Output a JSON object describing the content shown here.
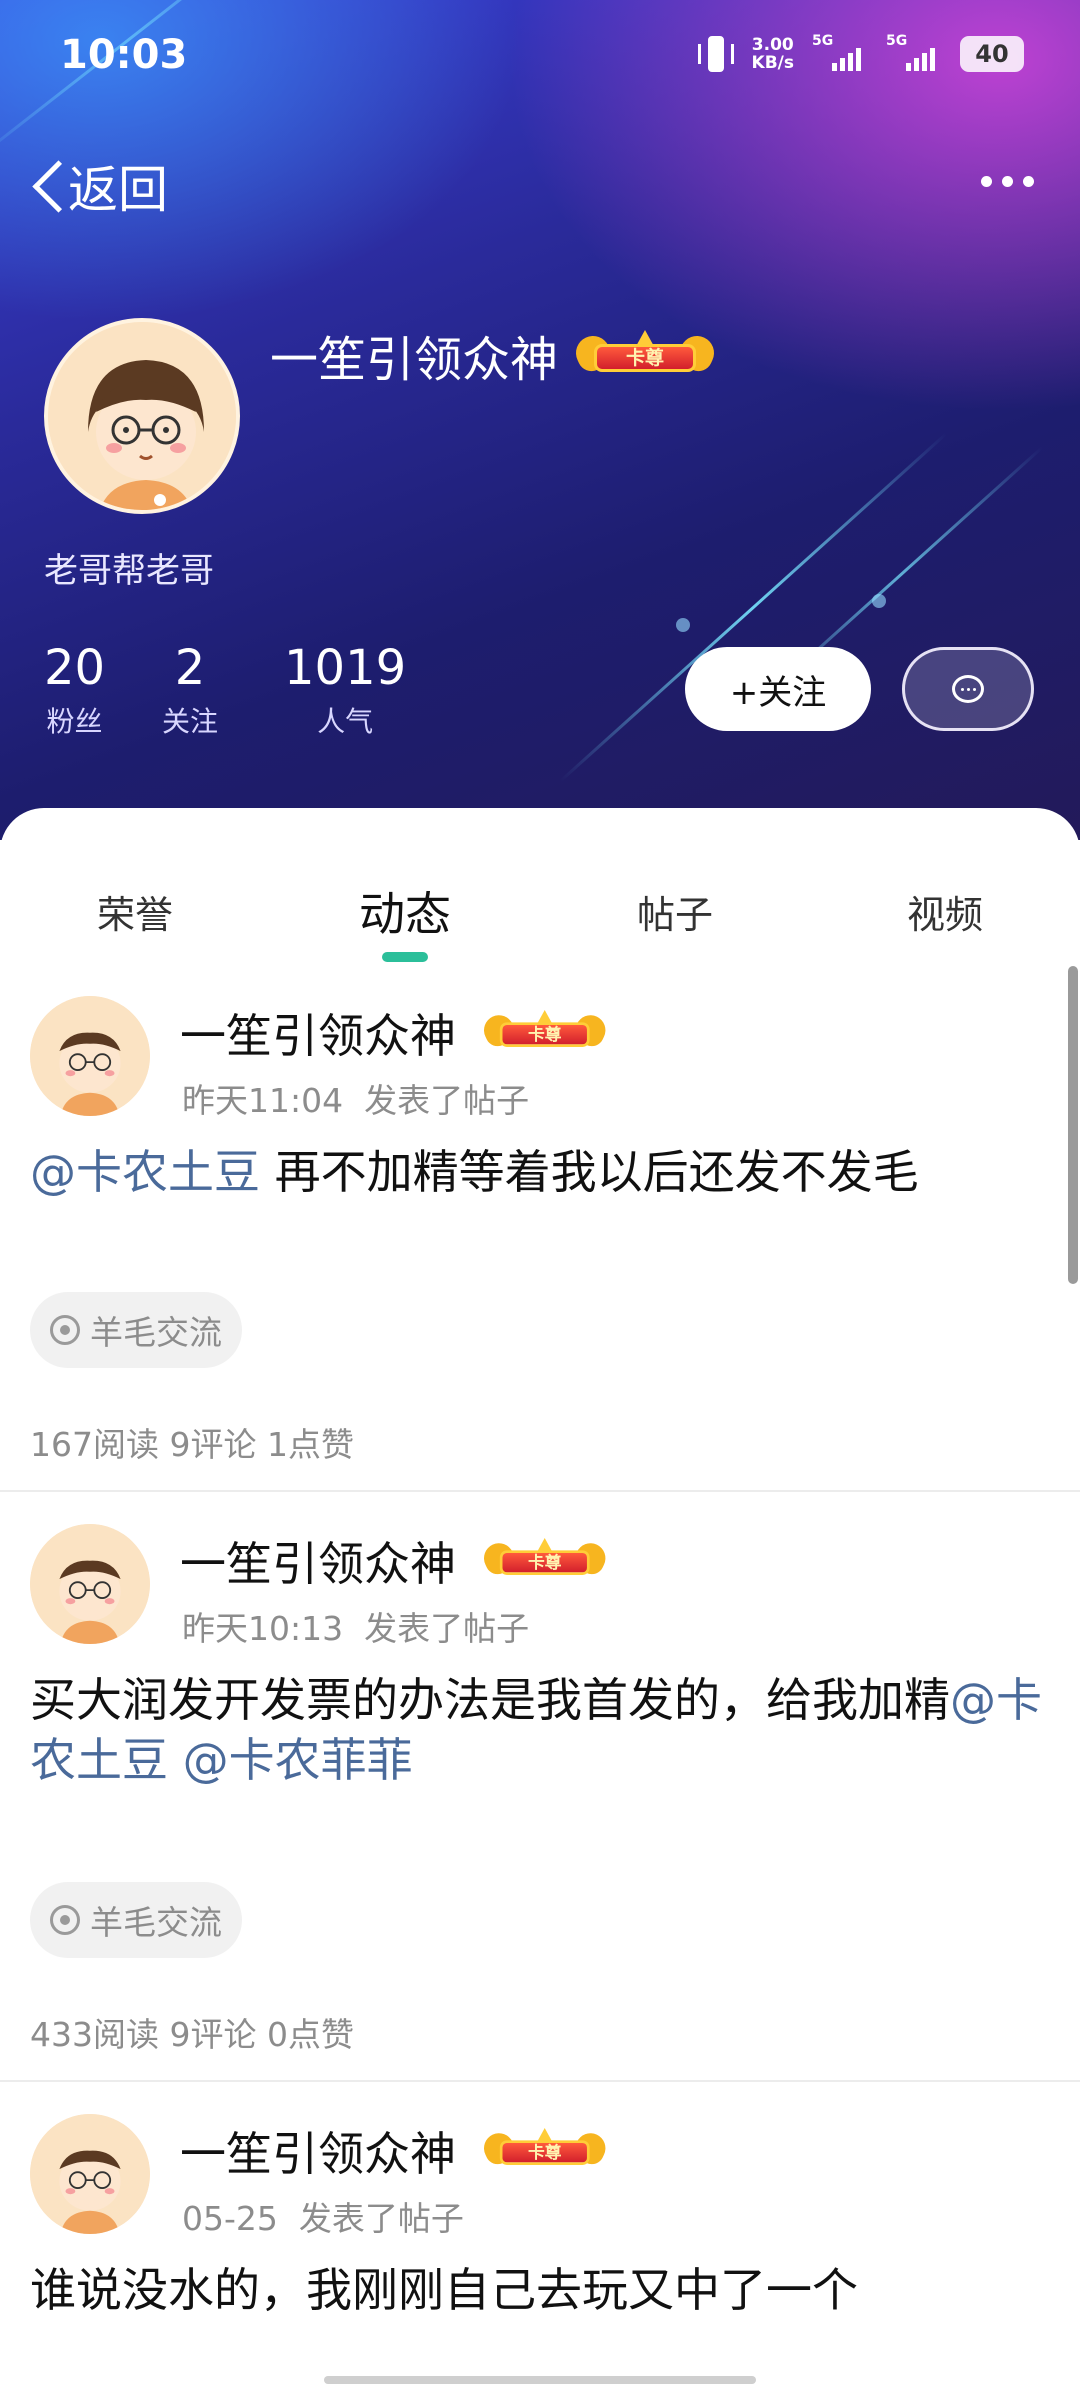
{
  "status_bar": {
    "time": "10:03",
    "net_speed_value": "3.00",
    "net_speed_unit": "KB/s",
    "sim1": "5G",
    "sim2": "5G",
    "battery": "40"
  },
  "nav": {
    "back_label": "返回"
  },
  "profile": {
    "username": "一笙引领众神",
    "badge": "卡尊",
    "bio": "老哥帮老哥",
    "stats": [
      {
        "value": "20",
        "label": "粉丝"
      },
      {
        "value": "2",
        "label": "关注"
      },
      {
        "value": "1019",
        "label": "人气"
      }
    ],
    "follow_label": "+关注"
  },
  "tabs": [
    {
      "label": "荣誉",
      "active": false
    },
    {
      "label": "动态",
      "active": true
    },
    {
      "label": "帖子",
      "active": false
    },
    {
      "label": "视频",
      "active": false
    }
  ],
  "posts": [
    {
      "author": "一笙引领众神",
      "badge": "卡尊",
      "time": "昨天11:04",
      "action": "发表了帖子",
      "mention1": "@卡农土豆",
      "text1": " 再不加精等着我以后还发不发毛",
      "topic": "羊毛交流",
      "stats": "167阅读 9评论 1点赞"
    },
    {
      "author": "一笙引领众神",
      "badge": "卡尊",
      "time": "昨天10:13",
      "action": "发表了帖子",
      "text1": "买大润发开发票的办法是我首发的，给我加精",
      "mention1": "@卡农土豆",
      "mention2": "@卡农菲菲",
      "topic": "羊毛交流",
      "stats": "433阅读 9评论 0点赞"
    },
    {
      "author": "一笙引领众神",
      "badge": "卡尊",
      "time": "05-25",
      "action": "发表了帖子",
      "text1": "谁说没水的，我刚刚自己去玩又中了一个"
    }
  ],
  "icons": [
    "back-icon",
    "more-icon",
    "chat-icon",
    "vibrate-icon",
    "signal-icon",
    "topic-icon",
    "crown-badge-icon"
  ]
}
